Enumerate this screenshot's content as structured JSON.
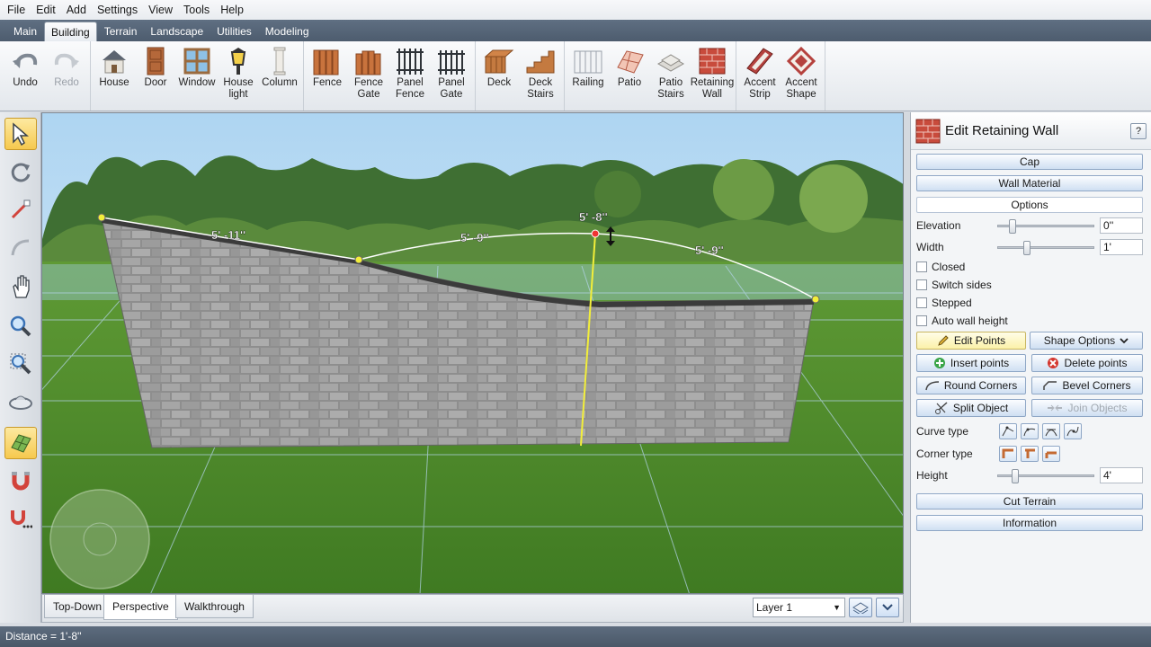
{
  "menu": [
    "File",
    "Edit",
    "Add",
    "Settings",
    "View",
    "Tools",
    "Help"
  ],
  "ribbon_tabs": [
    {
      "label": "Main",
      "active": false
    },
    {
      "label": "Building",
      "active": true
    },
    {
      "label": "Terrain",
      "active": false
    },
    {
      "label": "Landscape",
      "active": false
    },
    {
      "label": "Utilities",
      "active": false
    },
    {
      "label": "Modeling",
      "active": false
    }
  ],
  "ribbon": {
    "undo": "Undo",
    "redo": "Redo",
    "house": "House",
    "door": "Door",
    "window": "Window",
    "house_light": "House\nlight",
    "column": "Column",
    "fence": "Fence",
    "fence_gate": "Fence\nGate",
    "panel_fence": "Panel\nFence",
    "panel_gate": "Panel\nGate",
    "deck": "Deck",
    "deck_stairs": "Deck\nStairs",
    "railing": "Railing",
    "patio": "Patio",
    "patio_stairs": "Patio\nStairs",
    "retaining_wall": "Retaining\nWall",
    "accent_strip": "Accent\nStrip",
    "accent_shape": "Accent\nShape"
  },
  "viewport": {
    "dimensions": [
      "5' -11''",
      "5' -9''",
      "5' -8''",
      "5' -9''"
    ]
  },
  "view_tabs": {
    "top_down": "Top-Down",
    "perspective": "Perspective",
    "walkthrough": "Walkthrough"
  },
  "layer": "Layer 1",
  "panel": {
    "title": "Edit Retaining Wall",
    "help": "?",
    "cap": "Cap",
    "wall_material": "Wall Material",
    "options": "Options",
    "elevation_label": "Elevation",
    "elevation_value": "0''",
    "elevation_level": 0.15,
    "width_label": "Width",
    "width_value": "1'",
    "width_level": 0.3,
    "closed": "Closed",
    "switch_sides": "Switch sides",
    "stepped": "Stepped",
    "auto_wall_height": "Auto wall height",
    "edit_points": "Edit Points",
    "shape_options": "Shape Options",
    "insert_points": "Insert points",
    "delete_points": "Delete points",
    "round_corners": "Round Corners",
    "bevel_corners": "Bevel Corners",
    "split_object": "Split Object",
    "join_objects": "Join Objects",
    "curve_type": "Curve type",
    "corner_type": "Corner type",
    "height_label": "Height",
    "height_value": "4'",
    "height_level": 0.18,
    "cut_terrain": "Cut Terrain",
    "information": "Information"
  },
  "status": "Distance = 1'-8''",
  "colors": {
    "accent": "#f6c94e",
    "wall_line": "#ffffff",
    "height_marker": "#f2ee3a"
  }
}
